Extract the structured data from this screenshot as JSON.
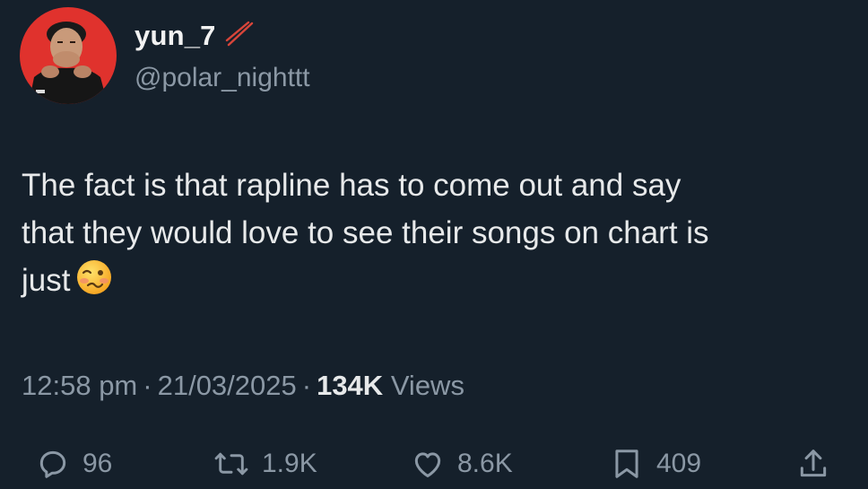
{
  "author": {
    "display_name": "yun_7",
    "handle": "@polar_nighttt",
    "avatar_icon": "profile-photo-icon",
    "badge_icon": "chopsticks-icon"
  },
  "tweet": {
    "lines": [
      "The fact is that rapline has to come out and say",
      "that they would love to see their songs on chart is",
      "just"
    ],
    "emoji": "woozy-face-emoji"
  },
  "meta": {
    "time": "12:58 pm",
    "separator": "·",
    "date": "21/03/2025",
    "views_count": "134K",
    "views_label": "Views"
  },
  "actions": {
    "replies": "96",
    "reposts": "1.9K",
    "likes": "8.6K",
    "bookmarks": "409"
  },
  "colors": {
    "background": "#15202b",
    "text_primary": "#e7e9ea",
    "text_secondary": "#8b98a5",
    "avatar_bg": "#e0322d"
  }
}
